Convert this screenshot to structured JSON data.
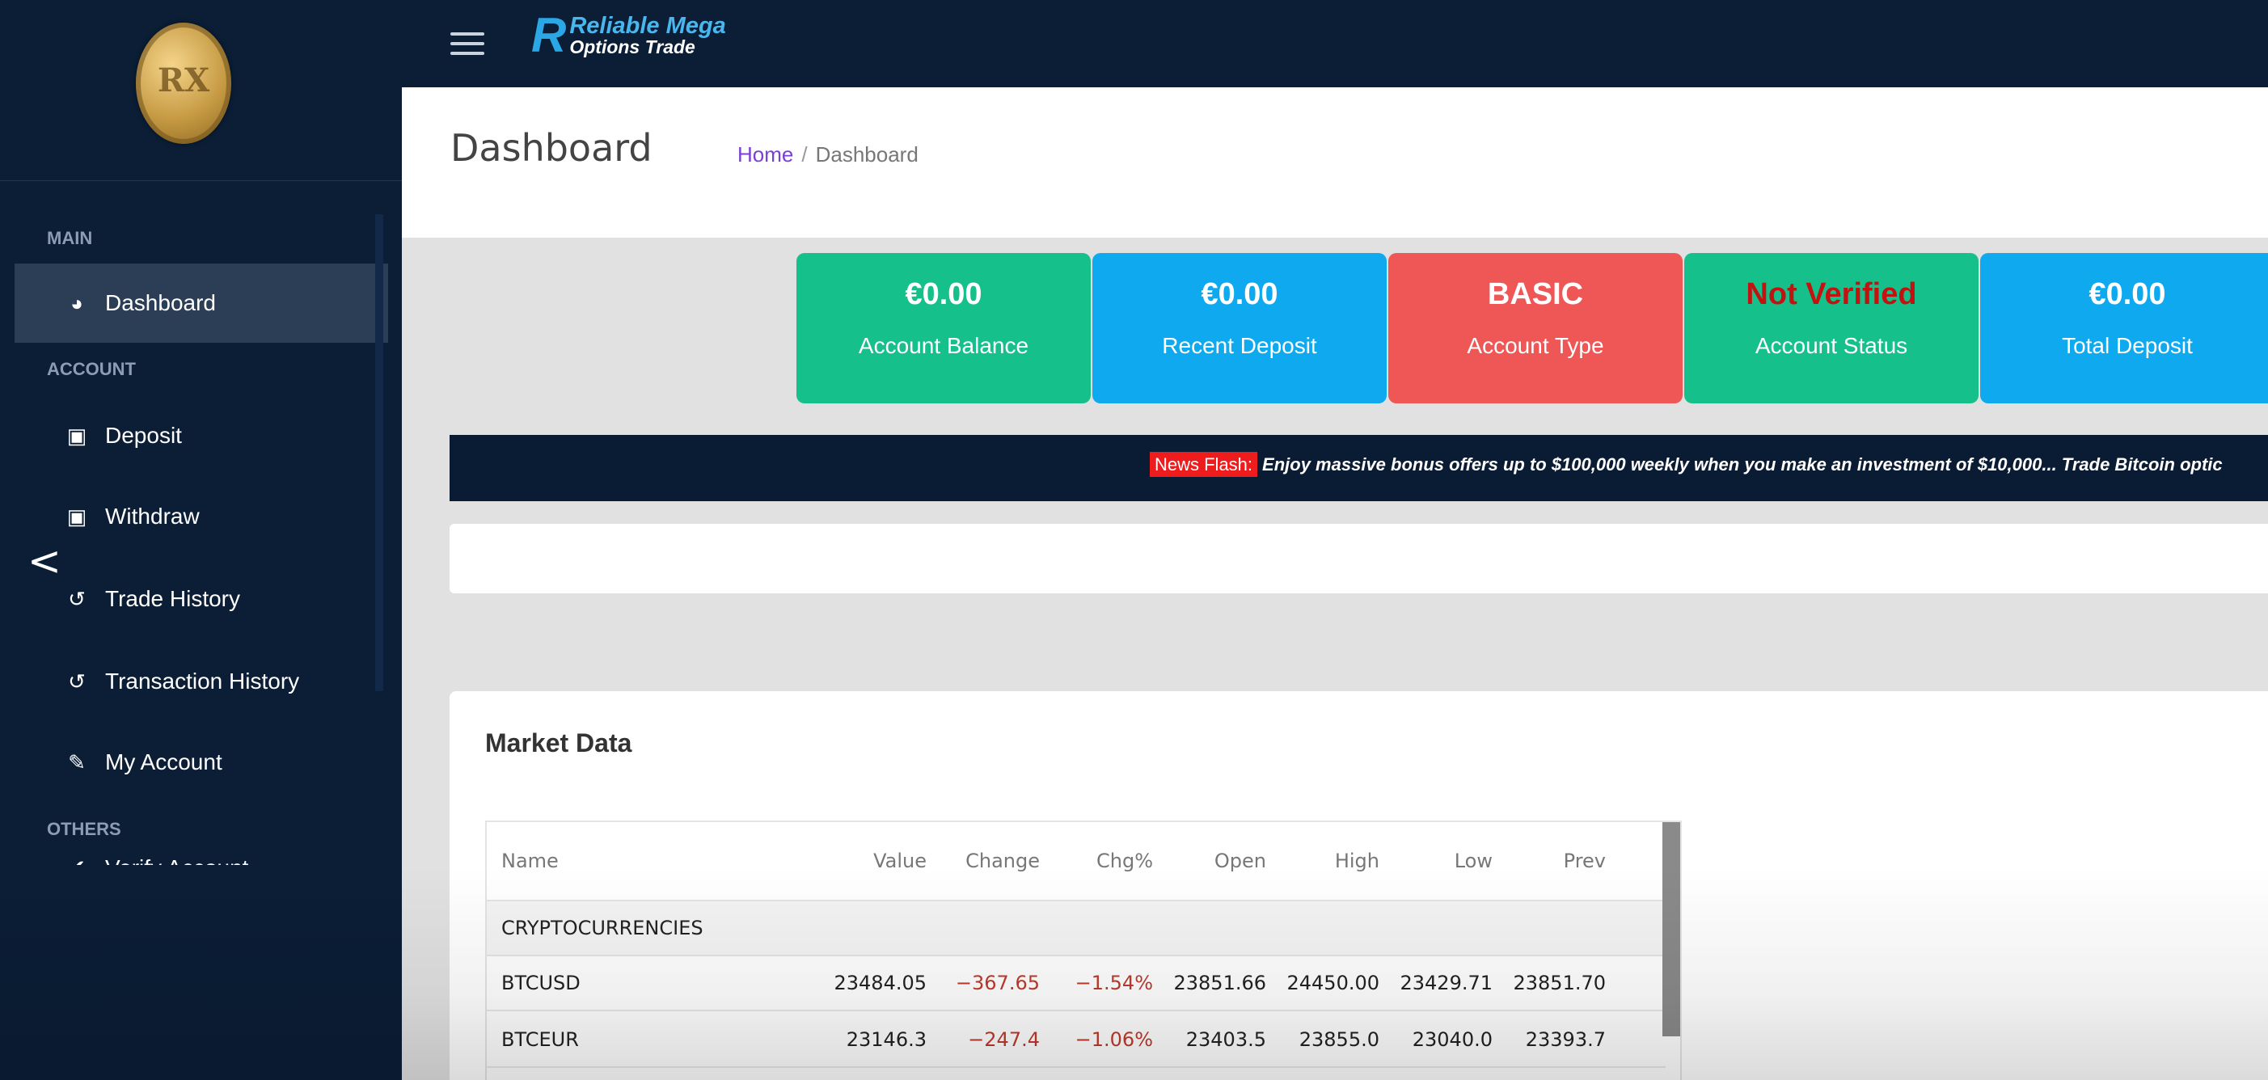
{
  "brand": {
    "line1": "Reliable Mega",
    "line2": "Options Trade",
    "mark": "R",
    "coin_mark": "RX"
  },
  "sidebar": {
    "sections": {
      "main": "MAIN",
      "account": "ACCOUNT",
      "others": "OTHERS"
    },
    "items": [
      {
        "label": "Dashboard",
        "icon": "dashboard-icon"
      },
      {
        "label": "Deposit",
        "icon": "money-icon"
      },
      {
        "label": "Withdraw",
        "icon": "money-icon"
      },
      {
        "label": "Trade History",
        "icon": "history-icon"
      },
      {
        "label": "Transaction History",
        "icon": "history-icon"
      },
      {
        "label": "My Account",
        "icon": "edit-icon"
      },
      {
        "label": "Verify Account",
        "icon": "check-icon"
      }
    ],
    "collapse_glyph": "<"
  },
  "header": {
    "title": "Dashboard",
    "breadcrumb": {
      "home": "Home",
      "sep": "/",
      "current": "Dashboard"
    }
  },
  "cards": [
    {
      "value": "€0.00",
      "label": "Account Balance",
      "color": "#16c08a"
    },
    {
      "value": "€0.00",
      "label": "Recent Deposit",
      "color": "#0ea9ee"
    },
    {
      "value": "BASIC",
      "label": "Account Type",
      "color": "#ef5656"
    },
    {
      "value": "Not Verified",
      "label": "Account Status",
      "color": "#16c08a"
    },
    {
      "value": "€0.00",
      "label": "Total Deposit",
      "color": "#0ea9ee"
    }
  ],
  "news": {
    "tag": "News Flash:",
    "text": "Enjoy massive bonus offers up to $100,000 weekly when you make an investment of $10,000... Trade Bitcoin optic"
  },
  "market": {
    "title": "Market Data",
    "columns": [
      "Name",
      "Value",
      "Change",
      "Chg%",
      "Open",
      "High",
      "Low",
      "Prev"
    ],
    "group": "CRYPTOCURRENCIES",
    "rows": [
      [
        "BTCUSD",
        "23484.05",
        "−367.65",
        "−1.54%",
        "23851.66",
        "24450.00",
        "23429.71",
        "23851.70"
      ],
      [
        "BTCEUR",
        "23146.3",
        "−247.4",
        "−1.06%",
        "23403.5",
        "23855.0",
        "23040.0",
        "23393.7"
      ]
    ]
  }
}
